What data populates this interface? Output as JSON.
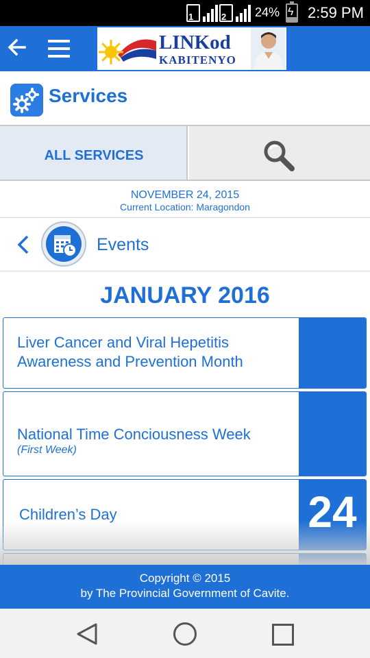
{
  "status_bar": {
    "sim1": "1",
    "sim2": "2",
    "battery_percent": "24%",
    "battery_level": 0.24,
    "time": "2:59 PM"
  },
  "app_bar": {
    "logo_line1": "LINKod",
    "logo_line2": "KABITENYO"
  },
  "services": {
    "title": "Services"
  },
  "tabs": {
    "all_services": "ALL SERVICES"
  },
  "info": {
    "date": "NOVEMBER 24, 2015",
    "location": "Current Location: Maragondon"
  },
  "events": {
    "title": "Events",
    "month": "JANUARY 2016",
    "items": [
      {
        "title_line1": "Liver Cancer and Viral Hepetitis",
        "title_line2": "Awareness and Prevention Month",
        "day": ""
      },
      {
        "title": "National Time Conciousness Week",
        "note": "(First Week)",
        "day": ""
      },
      {
        "title": "Children’s Day",
        "day": "24"
      }
    ]
  },
  "footer": {
    "line1": "Copyright © 2015",
    "line2": "by The Provincial Government of Cavite."
  },
  "colors": {
    "primary": "#1f70d6",
    "tab_active_bg": "#e4eaf3",
    "tab_inactive_bg": "#ececec"
  },
  "icons": [
    "back-arrow-icon",
    "menu-icon",
    "gear-icon",
    "search-icon",
    "chevron-left-icon",
    "calendar-clock-icon",
    "nav-back-icon",
    "nav-home-icon",
    "nav-recent-icon"
  ]
}
